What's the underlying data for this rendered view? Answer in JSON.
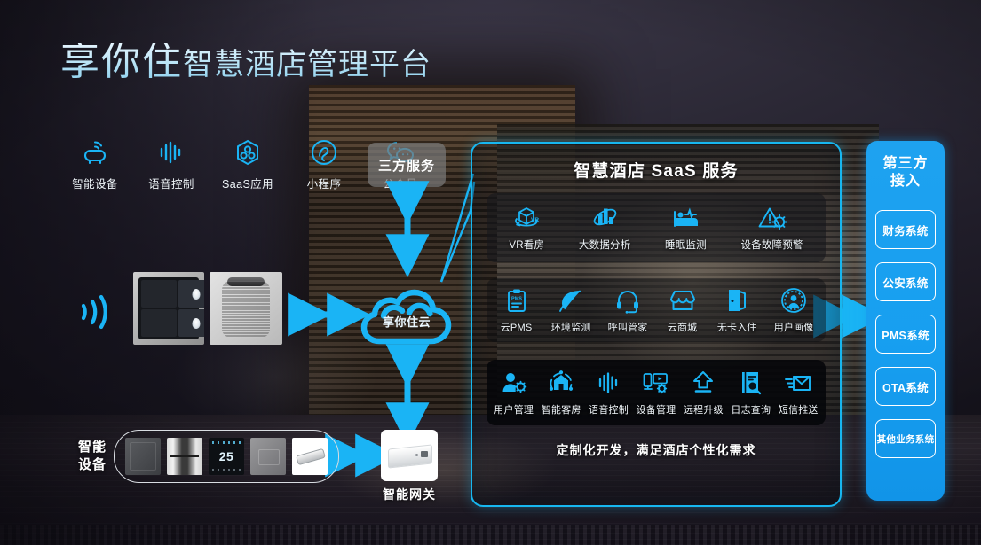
{
  "header": {
    "brand": "享你住",
    "subtitle": "智慧酒店管理平台"
  },
  "colors": {
    "accent_cyan": "#17b7f0",
    "accent_blue": "#1e9ef0",
    "panel_blue": "#1ea2f0",
    "text_white": "#ffffff"
  },
  "channels": [
    {
      "icon": "smart-device-icon",
      "label": "智能设备"
    },
    {
      "icon": "voice-waveform-icon",
      "label": "语音控制"
    },
    {
      "icon": "saas-hexagon-icon",
      "label": "SaaS应用"
    },
    {
      "icon": "mini-program-icon",
      "label": "小程序"
    },
    {
      "icon": "wechat-official-icon",
      "label": "公众号"
    }
  ],
  "third_party_service": {
    "label": "三方服务"
  },
  "cloud": {
    "label": "享你住云",
    "icon": "cloud-icon"
  },
  "saas": {
    "title": "智慧酒店 SaaS 服务",
    "footer": "定制化开发，满足酒店个性化需求",
    "row1": [
      {
        "icon": "vr-cube-icon",
        "label": "VR看房"
      },
      {
        "icon": "bar-chart-orbit-icon",
        "label": "大数据分析"
      },
      {
        "icon": "bed-pulse-icon",
        "label": "睡眠监测"
      },
      {
        "icon": "warning-gear-icon",
        "label": "设备故障预警"
      }
    ],
    "row2": [
      {
        "icon": "clipboard-pms-icon",
        "label": "云PMS"
      },
      {
        "icon": "leaf-icon",
        "label": "环境监测"
      },
      {
        "icon": "headset-icon",
        "label": "呼叫管家"
      },
      {
        "icon": "storefront-icon",
        "label": "云商城"
      },
      {
        "icon": "open-door-icon",
        "label": "无卡入住"
      },
      {
        "icon": "user-profile-circle-icon",
        "label": "用户画像"
      }
    ],
    "row3": [
      {
        "icon": "user-gear-icon",
        "label": "用户管理"
      },
      {
        "icon": "smart-room-icon",
        "label": "智能客房"
      },
      {
        "icon": "voice-waveform-icon",
        "label": "语音控制"
      },
      {
        "icon": "device-manage-icon",
        "label": "设备管理"
      },
      {
        "icon": "upload-arrow-icon",
        "label": "远程升级"
      },
      {
        "icon": "log-search-icon",
        "label": "日志查询"
      },
      {
        "icon": "sms-envelope-icon",
        "label": "短信推送"
      }
    ]
  },
  "third_party_access": {
    "title_line1": "第三方",
    "title_line2": "接入",
    "items": [
      {
        "label": "财务系统"
      },
      {
        "label": "公安系统"
      },
      {
        "label": "PMS系统"
      },
      {
        "label": "OTA系统"
      },
      {
        "label": "其他业务系统"
      }
    ]
  },
  "smart_devices": {
    "label_line1": "智能",
    "label_line2": "设备",
    "thermostat_value": "25",
    "items": [
      {
        "name": "switch-panel"
      },
      {
        "name": "door-lock"
      },
      {
        "name": "thermostat"
      },
      {
        "name": "wall-panel"
      },
      {
        "name": "light-strip"
      }
    ]
  },
  "gateway": {
    "label": "智能网关"
  }
}
